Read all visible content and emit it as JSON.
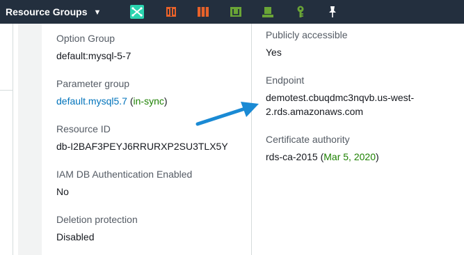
{
  "topbar": {
    "resource_groups_label": "Resource Groups",
    "pinned_services": [
      {
        "name": "aws-service-icon-1",
        "color": "#2bd4b0"
      },
      {
        "name": "aws-service-icon-2",
        "color": "#e8622a"
      },
      {
        "name": "aws-service-icon-3",
        "color": "#e8622a"
      },
      {
        "name": "aws-service-icon-4",
        "color": "#6aa536"
      },
      {
        "name": "aws-service-icon-5",
        "color": "#6aa536"
      },
      {
        "name": "aws-service-icon-6",
        "color": "#6aa536"
      }
    ]
  },
  "left_column": {
    "option_group": {
      "label": "Option Group",
      "value": "default:mysql-5-7"
    },
    "parameter_group": {
      "label": "Parameter group",
      "link": "default.mysql5.7",
      "open": " (",
      "status": "in-sync",
      "close": ")"
    },
    "resource_id": {
      "label": "Resource ID",
      "value": "db-I2BAF3PEYJ6RRURXP2SU3TLX5Y"
    },
    "iam_auth": {
      "label": "IAM DB Authentication Enabled",
      "value": "No"
    },
    "deletion_protection": {
      "label": "Deletion protection",
      "value": "Disabled"
    }
  },
  "right_column": {
    "publicly_accessible": {
      "label": "Publicly accessible",
      "value": "Yes"
    },
    "endpoint": {
      "label": "Endpoint",
      "line1": "demotest.cbuqdmc3nqvb.us-west-",
      "line2": "2.rds.amazonaws.com"
    },
    "certificate_authority": {
      "label": "Certificate authority",
      "name": "rds-ca-2015",
      "open": " (",
      "date": "Mar 5, 2020",
      "close": ")"
    }
  },
  "colors": {
    "topbar_bg": "#232f3e",
    "link": "#0073bb",
    "status_green": "#1d8102",
    "annotation_arrow": "#1a8ad4"
  }
}
